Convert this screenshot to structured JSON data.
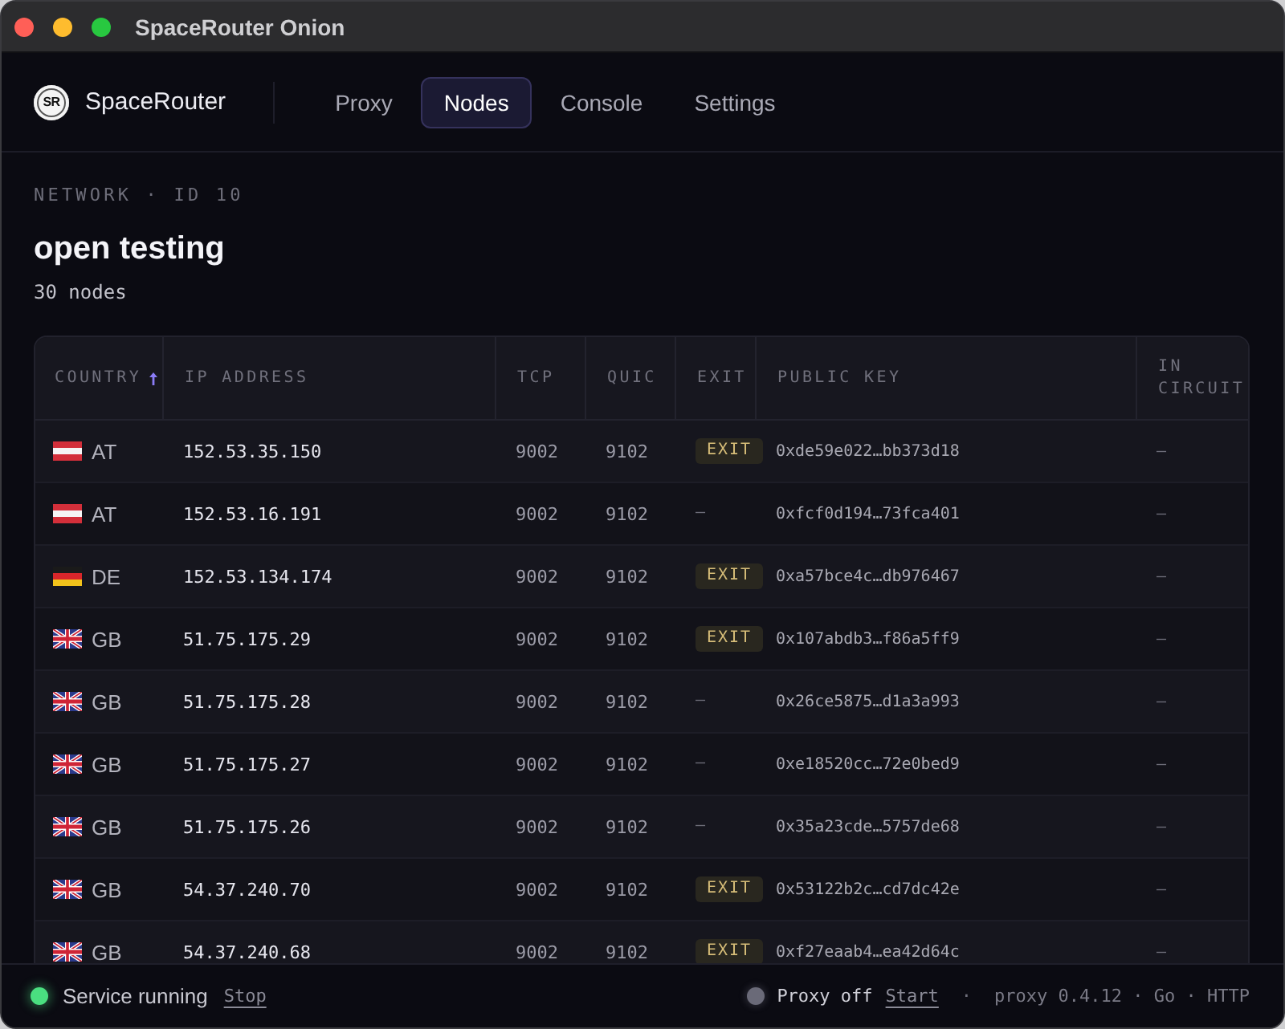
{
  "window": {
    "title": "SpaceRouter Onion"
  },
  "header": {
    "logo_text": "SR",
    "brand": "SpaceRouter",
    "tabs": [
      {
        "label": "Proxy",
        "selected": false
      },
      {
        "label": "Nodes",
        "selected": true
      },
      {
        "label": "Console",
        "selected": false
      },
      {
        "label": "Settings",
        "selected": false
      }
    ]
  },
  "network": {
    "eyebrow": "NETWORK · ID 10",
    "name": "open testing",
    "node_count": "30 nodes"
  },
  "table": {
    "columns": [
      {
        "label": "COUNTRY",
        "sorted": true
      },
      {
        "label": "IP ADDRESS",
        "sorted": false
      },
      {
        "label": "TCP",
        "sorted": false
      },
      {
        "label": "QUIC",
        "sorted": false
      },
      {
        "label": "EXIT",
        "sorted": false
      },
      {
        "label": "PUBLIC KEY",
        "sorted": false
      },
      {
        "label": "IN CIRCUIT",
        "sorted": false
      }
    ],
    "rows": [
      {
        "kind": "austria",
        "country": "AT",
        "ip": "152.53.35.150",
        "tcp": "9002",
        "quic": "9102",
        "exit": "EXIT",
        "is_exit": true,
        "public_key": "0xde59e022…bb373d18",
        "in_circuit": "—"
      },
      {
        "kind": "austria",
        "country": "AT",
        "ip": "152.53.16.191",
        "tcp": "9002",
        "quic": "9102",
        "exit": "—",
        "is_exit": false,
        "public_key": "0xfcf0d194…73fca401",
        "in_circuit": "—"
      },
      {
        "kind": "germany",
        "country": "DE",
        "ip": "152.53.134.174",
        "tcp": "9002",
        "quic": "9102",
        "exit": "EXIT",
        "is_exit": true,
        "public_key": "0xa57bce4c…db976467",
        "in_circuit": "—"
      },
      {
        "kind": "uk",
        "country": "GB",
        "ip": "51.75.175.29",
        "tcp": "9002",
        "quic": "9102",
        "exit": "EXIT",
        "is_exit": true,
        "public_key": "0x107abdb3…f86a5ff9",
        "in_circuit": "—"
      },
      {
        "kind": "uk",
        "country": "GB",
        "ip": "51.75.175.28",
        "tcp": "9002",
        "quic": "9102",
        "exit": "—",
        "is_exit": false,
        "public_key": "0x26ce5875…d1a3a993",
        "in_circuit": "—"
      },
      {
        "kind": "uk",
        "country": "GB",
        "ip": "51.75.175.27",
        "tcp": "9002",
        "quic": "9102",
        "exit": "—",
        "is_exit": false,
        "public_key": "0xe18520cc…72e0bed9",
        "in_circuit": "—"
      },
      {
        "kind": "uk",
        "country": "GB",
        "ip": "51.75.175.26",
        "tcp": "9002",
        "quic": "9102",
        "exit": "—",
        "is_exit": false,
        "public_key": "0x35a23cde…5757de68",
        "in_circuit": "—"
      },
      {
        "kind": "uk",
        "country": "GB",
        "ip": "54.37.240.70",
        "tcp": "9002",
        "quic": "9102",
        "exit": "EXIT",
        "is_exit": true,
        "public_key": "0x53122b2c…cd7dc42e",
        "in_circuit": "—"
      },
      {
        "kind": "uk",
        "country": "GB",
        "ip": "54.37.240.68",
        "tcp": "9002",
        "quic": "9102",
        "exit": "EXIT",
        "is_exit": true,
        "public_key": "0xf27eaab4…ea42d64c",
        "in_circuit": "—"
      }
    ]
  },
  "status_bar": {
    "service": {
      "label": "Service running",
      "running": true,
      "action": "Stop"
    },
    "proxy": {
      "label": "Proxy off",
      "running": false,
      "action": "Start"
    },
    "separator": "·",
    "build_info": "proxy 0.4.12 · Go · HTTP"
  }
}
